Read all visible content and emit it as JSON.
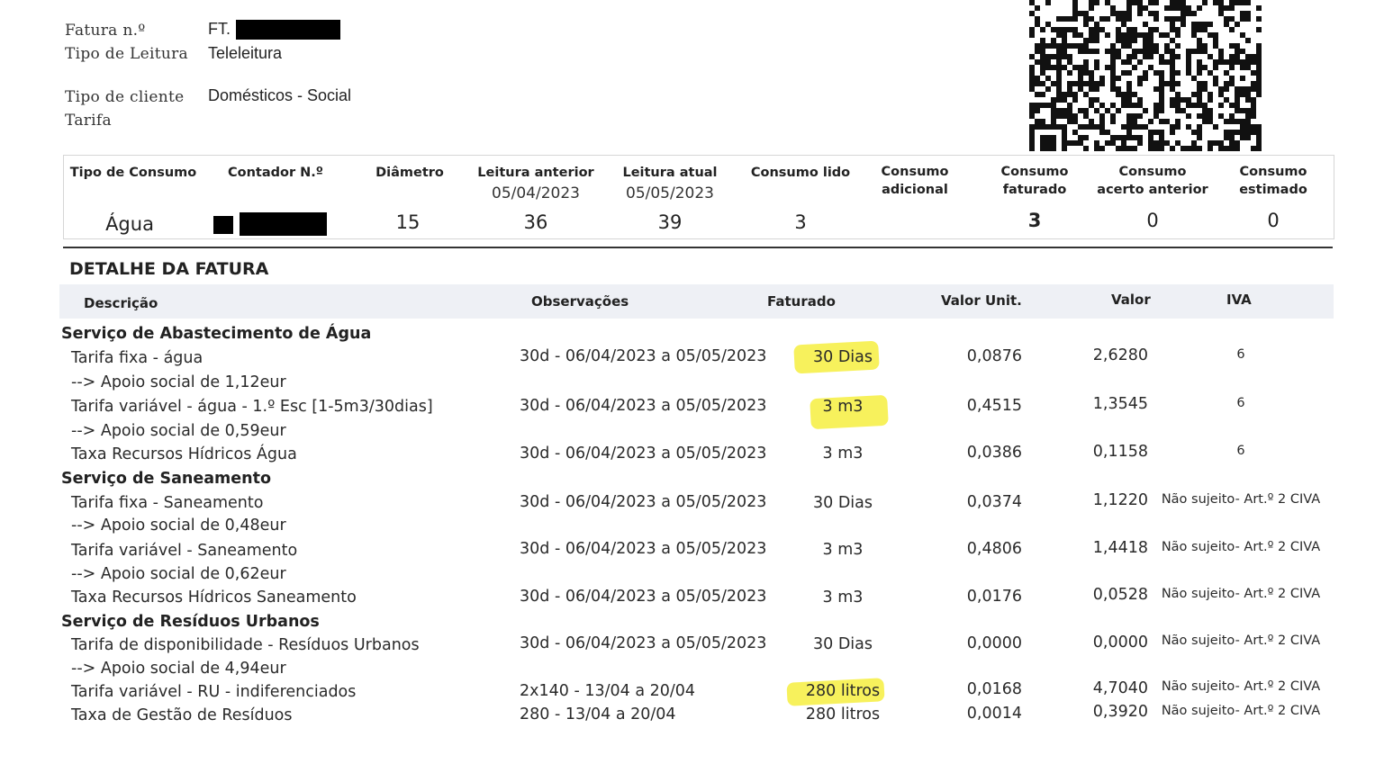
{
  "header": {
    "invoice_label": "Fatura n.º",
    "invoice_value": "FT.",
    "reading_type_label": "Tipo de Leitura",
    "reading_type_value": "Teleleitura",
    "client_type_label": "Tipo de cliente",
    "client_type_value": "Domésticos - Social",
    "tariff_label": "Tarifa"
  },
  "consumption": {
    "headers": {
      "tipo": "Tipo de Consumo",
      "contador": "Contador N.º",
      "diametro": "Diâmetro",
      "leitura_anterior": "Leitura anterior",
      "leitura_atual": "Leitura atual",
      "consumo_lido": "Consumo lido",
      "consumo_adicional": "Consumo adicional",
      "consumo_faturado": "Consumo faturado",
      "consumo_acerto": "Consumo acerto anterior",
      "consumo_estimado": "Consumo estimado"
    },
    "dates": {
      "anterior": "05/04/2023",
      "atual": "05/05/2023"
    },
    "values": {
      "tipo": "Água",
      "diametro": "15",
      "leitura_anterior": "36",
      "leitura_atual": "39",
      "consumo_lido": "3",
      "consumo_faturado": "3",
      "consumo_acerto": "0",
      "consumo_estimado": "0"
    }
  },
  "detail": {
    "title": "DETALHE DA FATURA",
    "columns": {
      "descricao": "Descrição",
      "observacoes": "Observações",
      "faturado": "Faturado",
      "valor_unit": "Valor Unit.",
      "valor": "Valor",
      "iva": "IVA"
    },
    "groups": [
      "Serviço de Abastecimento de Água",
      "Serviço de Saneamento",
      "Serviço de Resíduos Urbanos"
    ],
    "rows": [
      {
        "desc": "Tarifa fixa - água",
        "obs": "30d - 06/04/2023 a 05/05/2023",
        "fat": "30 Dias",
        "unit": "0,0876",
        "val": "2,6280",
        "iva": "6"
      },
      {
        "desc": "--> Apoio social de 1,12eur"
      },
      {
        "desc": "Tarifa variável - água - 1.º Esc [1-5m3/30dias]",
        "obs": "30d - 06/04/2023 a 05/05/2023",
        "fat": "3 m3",
        "unit": "0,4515",
        "val": "1,3545",
        "iva": "6"
      },
      {
        "desc": "--> Apoio social de 0,59eur"
      },
      {
        "desc": "Taxa Recursos Hídricos Água",
        "obs": "30d - 06/04/2023 a 05/05/2023",
        "fat": "3 m3",
        "unit": "0,0386",
        "val": "0,1158",
        "iva": "6"
      },
      {
        "desc": "Tarifa fixa - Saneamento",
        "obs": "30d - 06/04/2023 a 05/05/2023",
        "fat": "30 Dias",
        "unit": "0,0374",
        "val": "1,1220",
        "iva": "Não sujeito- Art.º 2 CIVA"
      },
      {
        "desc": "--> Apoio social de 0,48eur"
      },
      {
        "desc": "Tarifa variável - Saneamento",
        "obs": "30d - 06/04/2023 a 05/05/2023",
        "fat": "3 m3",
        "unit": "0,4806",
        "val": "1,4418",
        "iva": "Não sujeito- Art.º 2 CIVA"
      },
      {
        "desc": "--> Apoio social de 0,62eur"
      },
      {
        "desc": "Taxa Recursos Hídricos Saneamento",
        "obs": "30d - 06/04/2023 a 05/05/2023",
        "fat": "3 m3",
        "unit": "0,0176",
        "val": "0,0528",
        "iva": "Não sujeito- Art.º 2 CIVA"
      },
      {
        "desc": "Tarifa de disponibilidade - Resíduos Urbanos",
        "obs": "30d - 06/04/2023 a 05/05/2023",
        "fat": "30 Dias",
        "unit": "0,0000",
        "val": "0,0000",
        "iva": "Não sujeito- Art.º 2 CIVA"
      },
      {
        "desc": "--> Apoio social de 4,94eur"
      },
      {
        "desc": "Tarifa variável - RU - indiferenciados",
        "obs": "2x140 - 13/04 a 20/04",
        "fat": "280 litros",
        "unit": "0,0168",
        "val": "4,7040",
        "iva": "Não sujeito- Art.º 2 CIVA"
      },
      {
        "desc": "Taxa de Gestão de Resíduos",
        "obs": "280 - 13/04 a 20/04",
        "fat": "280 litros",
        "unit": "0,0014",
        "val": "0,3920",
        "iva": "Não sujeito- Art.º 2 CIVA"
      }
    ]
  },
  "highlight_color": "#f6f04a"
}
